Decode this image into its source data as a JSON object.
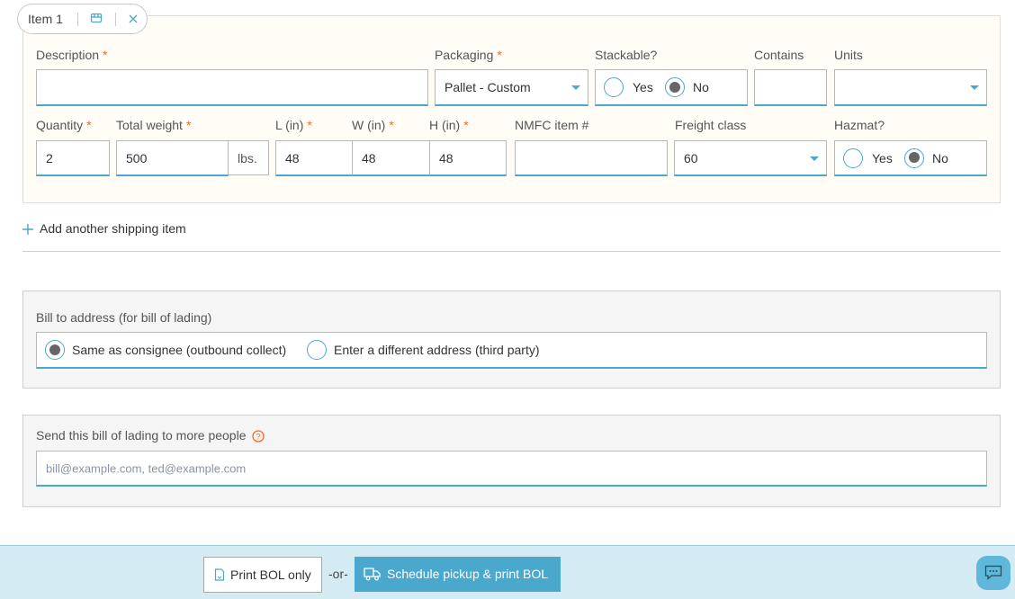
{
  "item": {
    "tab_label": "Item 1",
    "icons": {
      "package": "package-icon",
      "close": "close-icon"
    },
    "description": {
      "label": "Description",
      "value": ""
    },
    "packaging": {
      "label": "Packaging",
      "value": "Pallet - Custom"
    },
    "stackable": {
      "label": "Stackable?",
      "options": [
        "Yes",
        "No"
      ],
      "selected": "No"
    },
    "contains": {
      "label": "Contains",
      "value": ""
    },
    "units": {
      "label": "Units",
      "value": ""
    },
    "quantity": {
      "label": "Quantity",
      "value": "2"
    },
    "total_weight": {
      "label": "Total weight",
      "value": "500",
      "unit": "lbs."
    },
    "length": {
      "label": "L (in)",
      "value": "48"
    },
    "width": {
      "label": "W (in)",
      "value": "48"
    },
    "height": {
      "label": "H (in)",
      "value": "48"
    },
    "nmfc": {
      "label": "NMFC item #",
      "value": ""
    },
    "freight_class": {
      "label": "Freight class",
      "value": "60"
    },
    "hazmat": {
      "label": "Hazmat?",
      "options": [
        "Yes",
        "No"
      ],
      "selected": "No"
    },
    "required_marker": "*"
  },
  "add_item": {
    "icon": "plus-icon",
    "label": "Add another shipping item"
  },
  "bill_to": {
    "label": "Bill to address (for bill of lading)",
    "options": [
      "Same as consignee (outbound collect)",
      "Enter a different address (third party)"
    ],
    "selected": "Same as consignee (outbound collect)"
  },
  "send_to": {
    "label": "Send this bill of lading to more people",
    "help_icon": "question-circle-icon",
    "placeholder": "bill@example.com, ted@example.com",
    "value": ""
  },
  "footer": {
    "print_label": "Print BOL only",
    "or_label": "-or-",
    "schedule_label": "Schedule pickup & print BOL",
    "chat_icon": "chat-icon"
  },
  "colors": {
    "accent": "#4aa8cc",
    "required": "#f26b2a",
    "item_bg": "#fffdf6",
    "footer_bg": "#d5ebf4"
  }
}
